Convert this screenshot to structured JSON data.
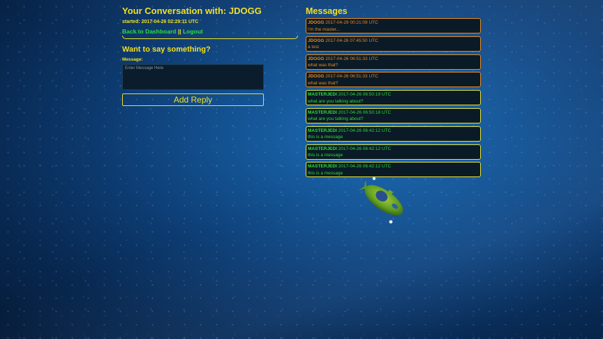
{
  "conversation": {
    "title": "Your Conversation with: JDOGG",
    "started": "started: 2017-04-26 02:29:11 UTC",
    "back_link": "Back to Dashboard",
    "separator": "||",
    "logout_link": "Logout"
  },
  "reply": {
    "heading": "Want to say something?",
    "message_label": "Message:",
    "placeholder": "Enter Message Here",
    "button_label": "Add Reply"
  },
  "messages": {
    "heading": "Messages",
    "items": [
      {
        "author": "JDOGG",
        "time": "2017-04-29 00:21:09 UTC",
        "text": "I'm the master...",
        "color": "#e88a1e"
      },
      {
        "author": "JDOGG",
        "time": "2017-04-26 07:45:50 UTC",
        "text": "a test",
        "color": "#e88a1e"
      },
      {
        "author": "JDOGG",
        "time": "2017-04-26 06:51:33 UTC",
        "text": "what was that?",
        "color": "#e88a1e"
      },
      {
        "author": "JDOGG",
        "time": "2017-04-26 06:51:33 UTC",
        "text": "what was that?",
        "color": "#e88a1e"
      },
      {
        "author": "MASTERJEDI",
        "time": "2017-04-26 06:50:19 UTC",
        "text": "what are you talking about?",
        "color": "#2adf36"
      },
      {
        "author": "MASTERJEDI",
        "time": "2017-04-26 06:50:18 UTC",
        "text": "what are you talking about?",
        "color": "#2adf36"
      },
      {
        "author": "MASTERJEDI",
        "time": "2017-04-26 06:42:12 UTC",
        "text": "this is a message",
        "color": "#2adf36"
      },
      {
        "author": "MASTERJEDI",
        "time": "2017-04-26 06:42:12 UTC",
        "text": "this is a message",
        "color": "#2adf36"
      },
      {
        "author": "MASTERJEDI",
        "time": "2017-04-26 06:42:12 UTC",
        "text": "this is a message",
        "color": "#2adf36"
      }
    ]
  },
  "colors": {
    "accent_yellow": "#f2e020",
    "link_green": "#2adf36",
    "other_orange": "#e88a1e",
    "background_blue": "#0d3c72"
  },
  "decoration": {
    "submarine": "green-submarine-icon"
  }
}
